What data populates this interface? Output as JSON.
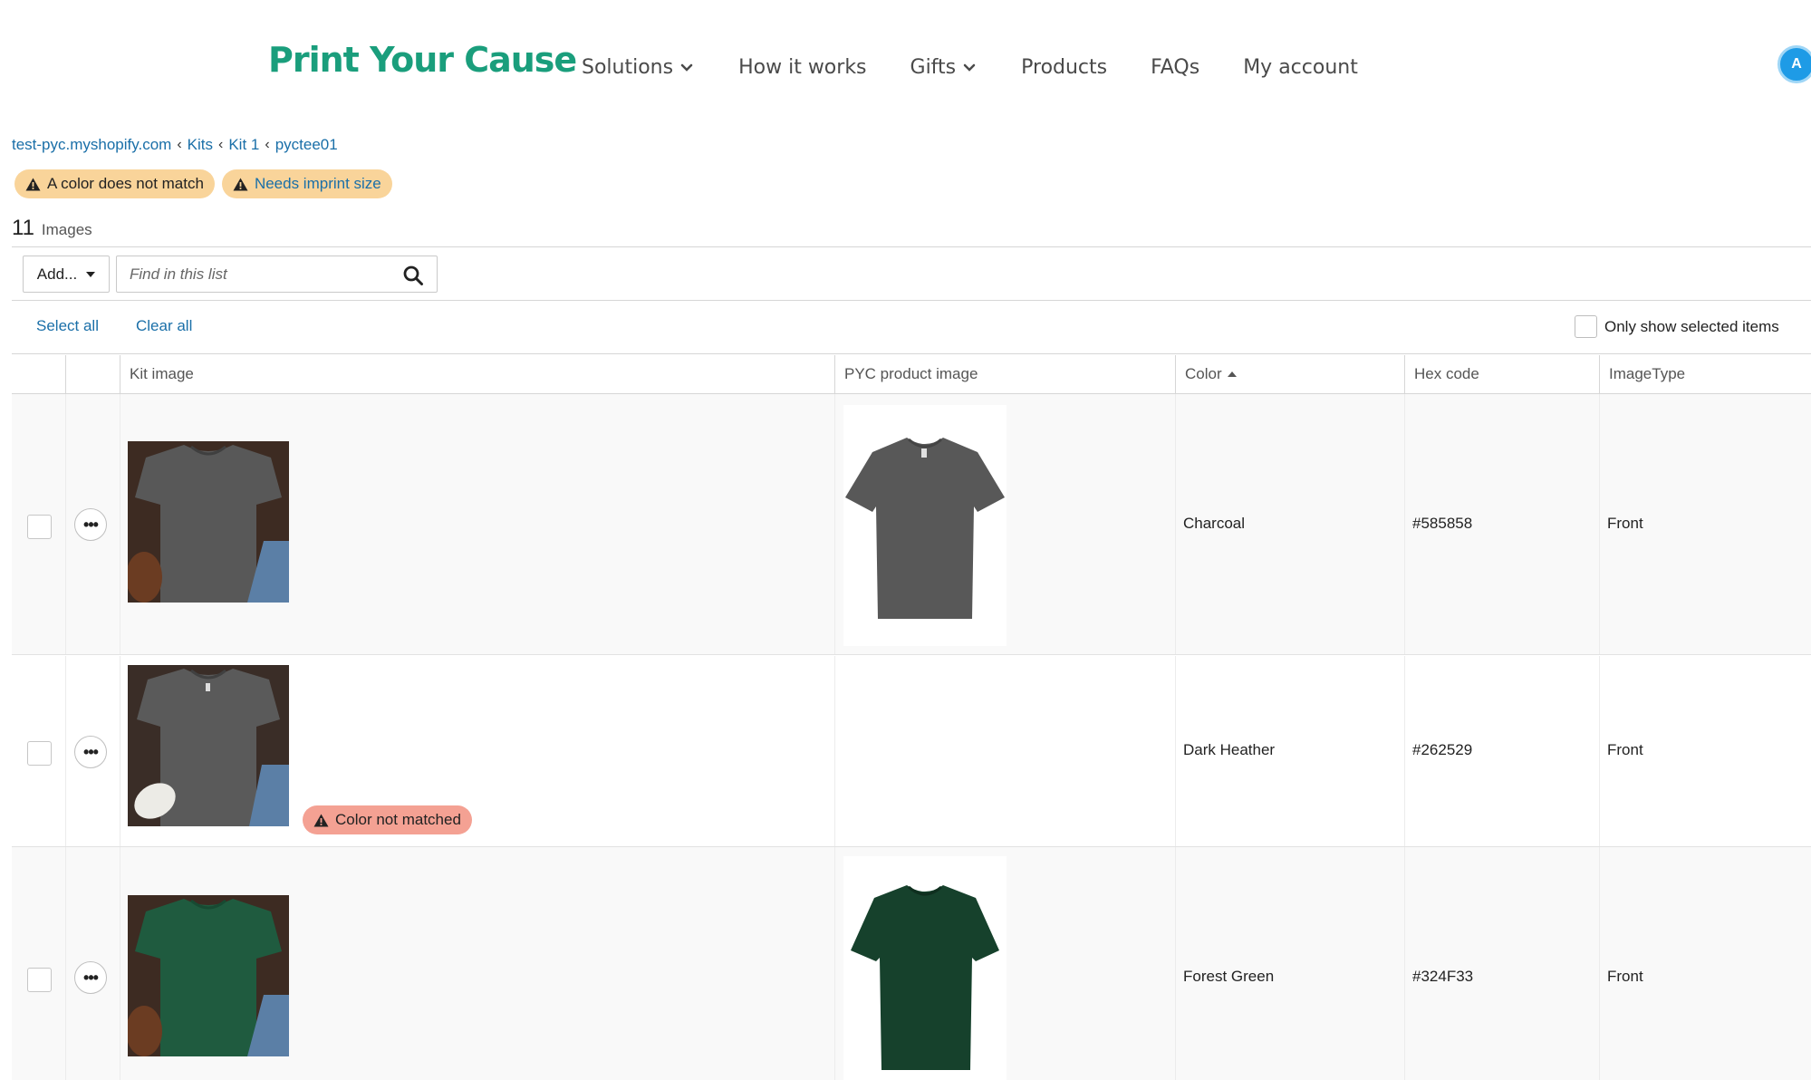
{
  "header": {
    "logo": "Print Your Cause",
    "nav": [
      {
        "label": "Solutions",
        "dropdown": true
      },
      {
        "label": "How it works",
        "dropdown": false
      },
      {
        "label": "Gifts",
        "dropdown": true
      },
      {
        "label": "Products",
        "dropdown": false
      },
      {
        "label": "FAQs",
        "dropdown": false
      },
      {
        "label": "My account",
        "dropdown": false
      }
    ],
    "avatar_initial": "A"
  },
  "breadcrumb": [
    "test-pyc.myshopify.com",
    "Kits",
    "Kit 1",
    "pyctee01"
  ],
  "warnings": [
    "A color does not match",
    "Needs imprint size"
  ],
  "list": {
    "count": "11",
    "count_label": "Images"
  },
  "toolbar": {
    "add_label": "Add...",
    "search_placeholder": "Find in this list",
    "select_all": "Select all",
    "clear_all": "Clear all",
    "only_selected": "Only show selected items"
  },
  "table": {
    "columns": [
      "Kit image",
      "PYC product image",
      "Color",
      "Hex code",
      "ImageType"
    ],
    "sorted_column": "Color",
    "rows": [
      {
        "color": "Charcoal",
        "hex": "#585858",
        "image_type": "Front",
        "swatch": "#585858",
        "has_pyc_image": true,
        "badge": ""
      },
      {
        "color": "Dark Heather",
        "hex": "#262529",
        "image_type": "Front",
        "swatch": "#5a5a5a",
        "has_pyc_image": false,
        "badge": "Color not matched"
      },
      {
        "color": "Forest Green",
        "hex": "#324F33",
        "image_type": "Front",
        "swatch": "#1f5b3f",
        "has_pyc_image": true,
        "badge": ""
      }
    ]
  },
  "colors": {
    "brand": "#1a9e7c",
    "link": "#1a6fa8",
    "warning_bg": "#f9d49a",
    "error_bg": "#f4a193",
    "avatar": "#1e9be6"
  }
}
